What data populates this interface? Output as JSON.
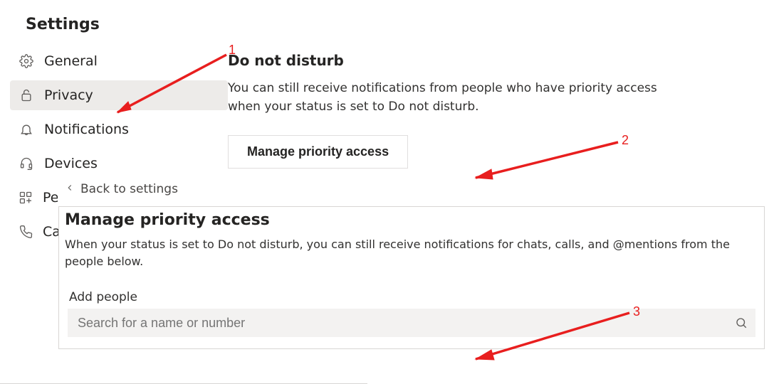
{
  "title": "Settings",
  "sidebar": {
    "items": [
      {
        "label": "General",
        "icon": "gear-icon"
      },
      {
        "label": "Privacy",
        "icon": "lock-icon"
      },
      {
        "label": "Notifications",
        "icon": "bell-icon"
      },
      {
        "label": "Devices",
        "icon": "headset-icon"
      },
      {
        "label": "Pe",
        "icon": "apps-icon"
      },
      {
        "label": "Ca",
        "icon": "phone-icon"
      }
    ]
  },
  "main": {
    "heading": "Do not disturb",
    "description": "You can still receive notifications from people who have priority access when your status is set to Do not disturb.",
    "button_label": "Manage priority access"
  },
  "panel": {
    "back_label": "Back to settings",
    "title": "Manage priority access",
    "description": "When your status is set to Do not disturb, you can still receive notifications for chats, calls, and @mentions from the people below.",
    "add_label": "Add people",
    "search_placeholder": "Search for a name or number"
  },
  "annotations": {
    "n1": "1",
    "n2": "2",
    "n3": "3"
  }
}
